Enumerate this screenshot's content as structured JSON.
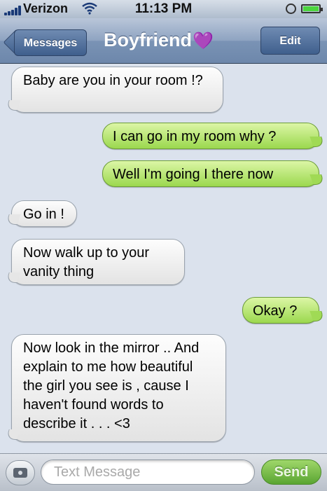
{
  "status_bar": {
    "carrier": "Verizon",
    "time": "11:13 PM",
    "icons": [
      "signal-icon",
      "wifi-icon",
      "rotation-lock-icon",
      "battery-icon"
    ],
    "battery_color": "#4bd53e"
  },
  "nav": {
    "back_label": "Messages",
    "title": "Boyfriend",
    "title_emoji": "💜",
    "edit_label": "Edit"
  },
  "messages": [
    {
      "side": "received",
      "text": "Baby are you in your room !?"
    },
    {
      "side": "sent",
      "text": "I can go in my room why ?"
    },
    {
      "side": "sent",
      "text": "Well I'm going I there now"
    },
    {
      "side": "received",
      "text": "Go in !"
    },
    {
      "side": "received",
      "text": "Now walk up to your vanity thing"
    },
    {
      "side": "sent",
      "text": "Okay ?"
    },
    {
      "side": "received",
      "text": "Now look in the mirror .. And explain to me how beautiful the girl you see is , cause I haven't found words to describe it . . . <3"
    }
  ],
  "input_bar": {
    "placeholder": "Text Message",
    "send_label": "Send"
  },
  "colors": {
    "background": "#dbe2ed",
    "sent_bubble": "#9bd84e",
    "received_bubble": "#e3e3e3",
    "nav_bar": "#7a93b5"
  }
}
